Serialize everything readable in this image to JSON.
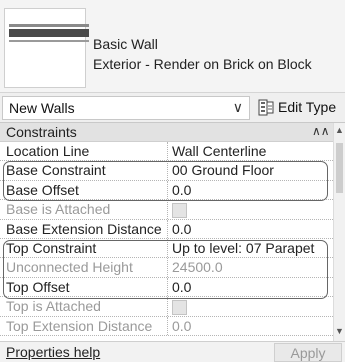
{
  "type_preview": {
    "family": "Basic Wall",
    "type_name": "Exterior - Render on Brick on Block",
    "swatch_icon": "wall-layers-icon"
  },
  "selector": {
    "value": "New Walls",
    "edit_type_label": "Edit Type"
  },
  "group": {
    "label": "Constraints",
    "collapse_icon": "collapse-double-chevron-icon"
  },
  "properties": [
    {
      "param": "Location Line",
      "value": "Wall Centerline",
      "enabled": true
    },
    {
      "param": "Base Constraint",
      "value": "00 Ground Floor",
      "enabled": true
    },
    {
      "param": "Base Offset",
      "value": "0.0",
      "enabled": true
    },
    {
      "param": "Base is Attached",
      "value": "",
      "checkbox": true,
      "enabled": false
    },
    {
      "param": "Base Extension Distance",
      "value": "0.0",
      "enabled": true
    },
    {
      "param": "Top Constraint",
      "value": "Up to level: 07 Parapet",
      "enabled": true
    },
    {
      "param": "Unconnected Height",
      "value": "24500.0",
      "enabled": false
    },
    {
      "param": "Top Offset",
      "value": "0.0",
      "enabled": true
    },
    {
      "param": "Top is Attached",
      "value": "",
      "checkbox": true,
      "enabled": false
    },
    {
      "param": "Top Extension Distance",
      "value": "0.0",
      "enabled": false
    }
  ],
  "footer": {
    "help_link": "Properties help",
    "apply_label": "Apply"
  },
  "colors": {
    "highlight_border": "#666666",
    "disabled_text": "#9a9a9a"
  }
}
